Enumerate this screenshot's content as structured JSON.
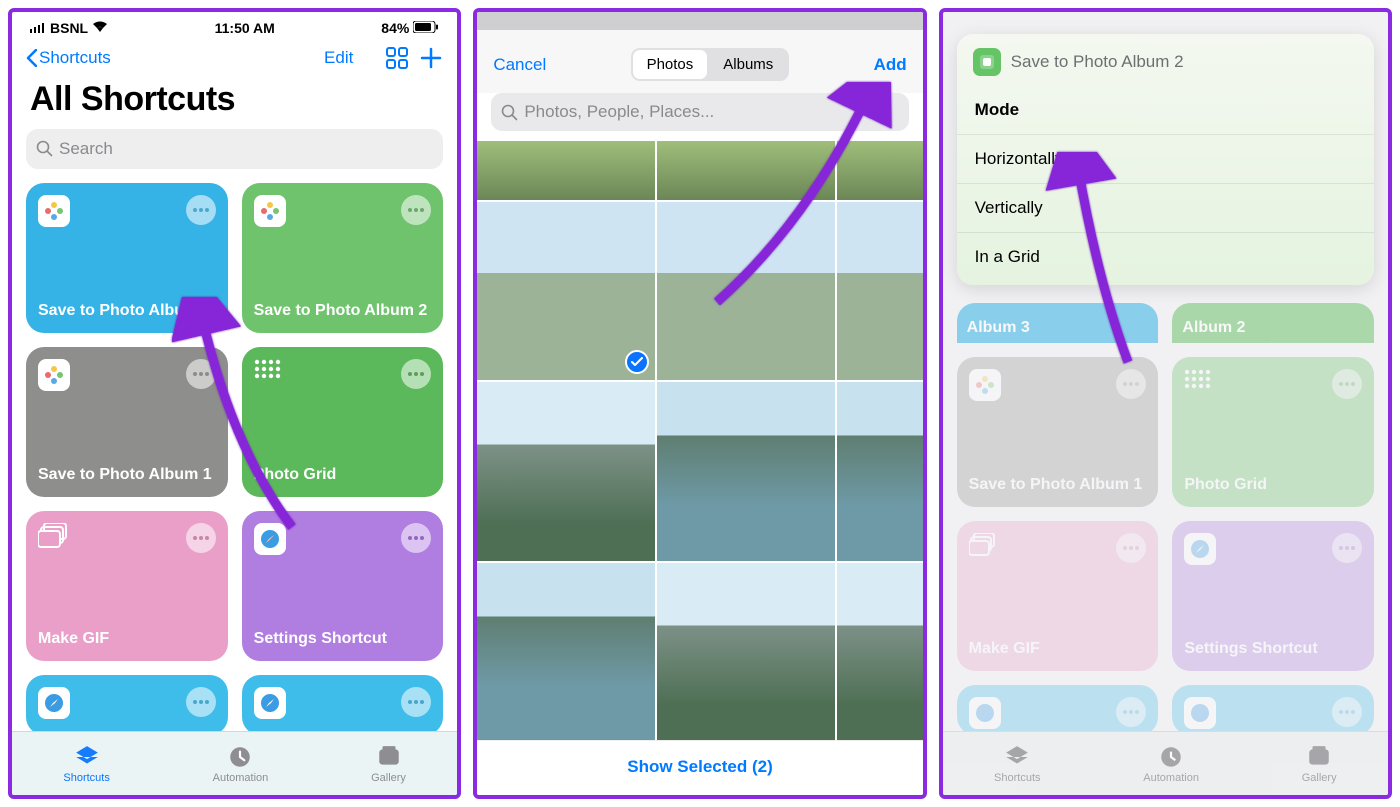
{
  "screen1": {
    "status": {
      "carrier": "BSNL",
      "time": "11:50 AM",
      "battery": "84%"
    },
    "nav": {
      "back": "Shortcuts",
      "edit": "Edit"
    },
    "title": "All Shortcuts",
    "search_placeholder": "Search",
    "tabs": {
      "shortcuts": "Shortcuts",
      "automation": "Automation",
      "gallery": "Gallery"
    },
    "cards": [
      {
        "label": "Save to Photo Album 3"
      },
      {
        "label": "Save to Photo Album 2"
      },
      {
        "label": "Save to Photo Album 1"
      },
      {
        "label": "Photo Grid"
      },
      {
        "label": "Make GIF"
      },
      {
        "label": "Settings Shortcut"
      }
    ]
  },
  "screen2": {
    "cancel": "Cancel",
    "segments": {
      "photos": "Photos",
      "albums": "Albums"
    },
    "add": "Add",
    "search_placeholder": "Photos, People, Places...",
    "show_selected": "Show Selected (2)"
  },
  "screen3": {
    "sheet_title": "Save to Photo Album 2",
    "rows": {
      "mode": "Mode",
      "h": "Horizontally",
      "v": "Vertically",
      "g": "In a Grid"
    },
    "bg_pills": {
      "a3": "Album 3",
      "a2": "Album 2"
    },
    "bg_cards": [
      {
        "label": "Save to Photo Album 1"
      },
      {
        "label": "Photo Grid"
      },
      {
        "label": "Make GIF"
      },
      {
        "label": "Settings Shortcut"
      }
    ],
    "tabs": {
      "shortcuts": "Shortcuts",
      "automation": "Automation",
      "gallery": "Gallery"
    }
  }
}
